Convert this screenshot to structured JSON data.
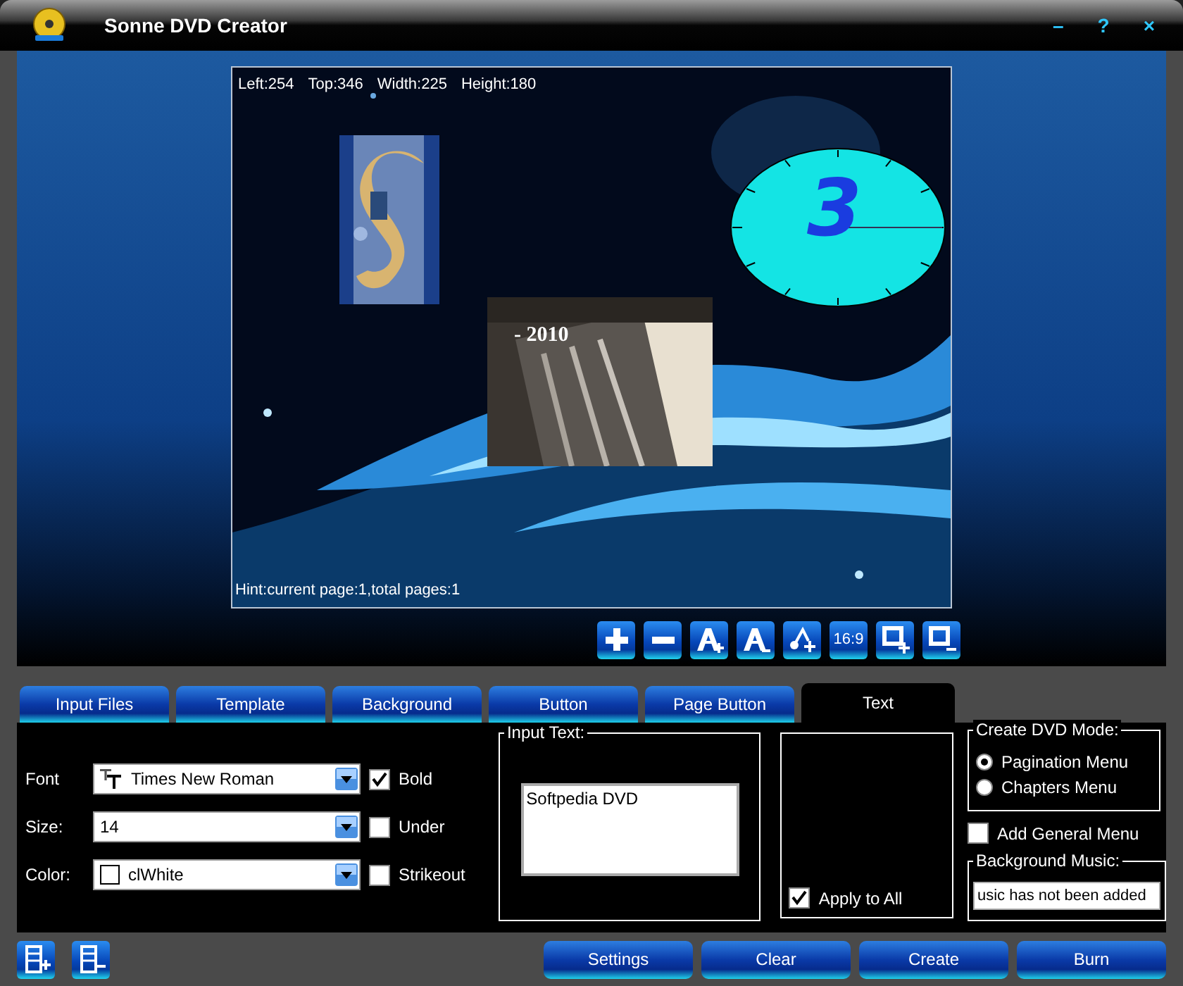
{
  "window": {
    "title": "Sonne DVD Creator",
    "controls": [
      "–",
      "?",
      "×"
    ]
  },
  "preview": {
    "info": [
      "Left:254",
      "Top:346",
      "Width:225",
      "Height:180"
    ],
    "hint": "Hint:current page:1,total pages:1",
    "objects": [
      {
        "kind": "picture"
      },
      {
        "kind": "clock",
        "text": "3"
      },
      {
        "kind": "picture"
      },
      {
        "kind": "text",
        "text": "- 2010"
      }
    ]
  },
  "toolbar": [
    {
      "kind": "add"
    },
    {
      "kind": "remove"
    },
    {
      "kind": "font-up"
    },
    {
      "kind": "font-down"
    },
    {
      "kind": "node-add"
    },
    {
      "kind": "ratio",
      "label": "16:9"
    },
    {
      "kind": "zoom-in"
    },
    {
      "kind": "zoom-out"
    }
  ],
  "tabs": [
    {
      "label": "Input Files",
      "selected": false
    },
    {
      "label": "Template",
      "selected": false
    },
    {
      "label": "Background",
      "selected": false
    },
    {
      "label": "Button",
      "selected": false
    },
    {
      "label": "Page Button",
      "selected": false
    },
    {
      "label": "Text",
      "selected": true
    }
  ],
  "text_panel": {
    "fields": [
      {
        "label": "Font",
        "value": "Times New Roman",
        "kind": "font"
      },
      {
        "label": "Size:",
        "value": "14",
        "kind": "plain"
      },
      {
        "label": "Color:",
        "value": "clWhite",
        "kind": "color"
      }
    ],
    "styles": [
      {
        "label": "Bold",
        "checked": true
      },
      {
        "label": "Under",
        "checked": false
      },
      {
        "label": "Strikeout",
        "checked": false
      }
    ],
    "input_text": {
      "title": "Input Text:",
      "value": "Softpedia DVD"
    },
    "apply_to_all": {
      "label": "Apply to All",
      "checked": true
    },
    "dvd_mode": {
      "title": "Create DVD Mode:",
      "options": [
        {
          "label": "Pagination Menu",
          "selected": true
        },
        {
          "label": "Chapters Menu",
          "selected": false
        }
      ]
    },
    "general_menu": {
      "label": "Add General Menu",
      "checked": false
    },
    "music": {
      "title": "Background Music:",
      "value": "usic has not been added"
    }
  },
  "film_buttons": [
    {
      "kind": "add"
    },
    {
      "kind": "remove"
    }
  ],
  "bottom_buttons": [
    "Settings",
    "Clear",
    "Create",
    "Burn"
  ]
}
